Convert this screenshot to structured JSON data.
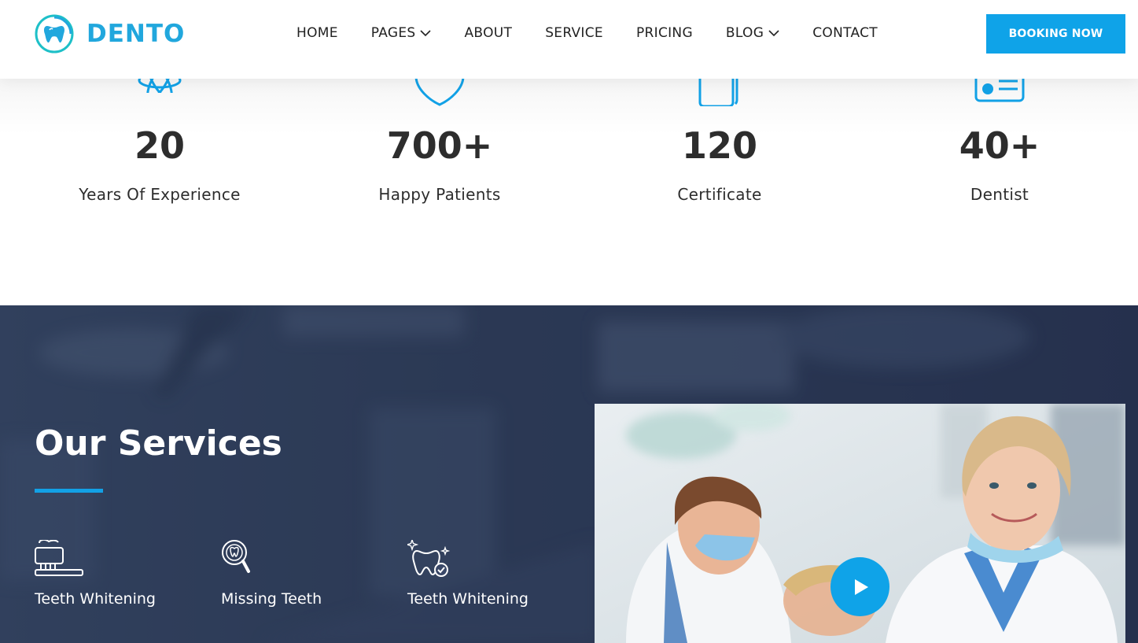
{
  "brand": {
    "name": "DENTO",
    "accent_color": "#0fa3e8"
  },
  "nav": {
    "items": [
      {
        "label": "HOME",
        "has_dropdown": false
      },
      {
        "label": "PAGES",
        "has_dropdown": true
      },
      {
        "label": "ABOUT",
        "has_dropdown": false
      },
      {
        "label": "SERVICE",
        "has_dropdown": false
      },
      {
        "label": "PRICING",
        "has_dropdown": false
      },
      {
        "label": "BLOG",
        "has_dropdown": true
      },
      {
        "label": "CONTACT",
        "has_dropdown": false
      }
    ],
    "cta_label": "BOOKING NOW"
  },
  "stats": [
    {
      "value": "20",
      "label": "Years Of Experience",
      "icon": "atom-icon"
    },
    {
      "value": "700+",
      "label": "Happy Patients",
      "icon": "shield-icon"
    },
    {
      "value": "120",
      "label": "Certificate",
      "icon": "certificate-icon"
    },
    {
      "value": "40+",
      "label": "Dentist",
      "icon": "id-card-icon"
    }
  ],
  "services": {
    "title": "Our Services",
    "items": [
      {
        "label": "Teeth Whitening",
        "icon": "toothbrush-icon"
      },
      {
        "label": "Missing Teeth",
        "icon": "tooth-magnifier-icon"
      },
      {
        "label": "Teeth Whitening",
        "icon": "sparkling-tooth-icon"
      }
    ],
    "video": {
      "icon": "play-icon"
    }
  }
}
